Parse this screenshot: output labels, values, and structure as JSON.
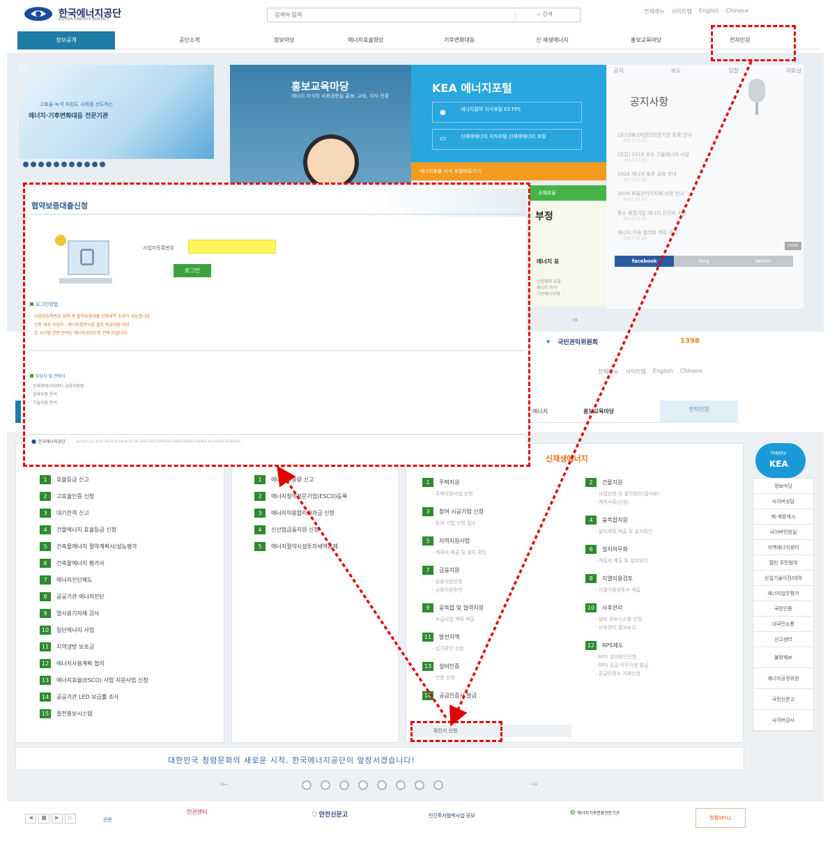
{
  "header": {
    "logo_text": "한국에너지공단",
    "logo_sub": "KOREA ENERGY AGENCY",
    "search_placeholder": "검색어 입력",
    "search_button": "검색",
    "top_links": [
      "전체메뉴",
      "사이트맵",
      "English",
      "Chinese"
    ]
  },
  "nav": {
    "items": [
      "정보공개",
      "공단소개",
      "정보마당",
      "에너지효율향상",
      "기후변화대응",
      "신·재생에너지",
      "홍보교육마당",
      "전자민원"
    ]
  },
  "banner": {
    "left_line1": "고효율·녹색 자원도 사회를 선도하는",
    "left_line2": "에너지·기후변화대응 전문기관",
    "promo_title": "홍보교육마당",
    "promo_desc": "에너지 지식의 사회공헌을 홍보, 교육, 지식 전환",
    "portal_title": "KEA 에너지포털",
    "portal_btn1": "에너지절약 지식포털 ES·FPS",
    "portal_btn2": "신재생에너지 지식포털 신재생에너지 포털",
    "strip_text": "에너지효율 지식 포털바로가기",
    "bottom_text": "소재효율",
    "bottom_frag": "부정",
    "bottom_frag2": "에너지 표",
    "energy_lines": [
      "산업체의 효율",
      "에너지 지식",
      "기존에너지에"
    ]
  },
  "notice": {
    "tabs": [
      "공지",
      "보도",
      "입찰",
      "자료실"
    ],
    "title": "공지사항",
    "items": [
      {
        "text": "[공고]에너지진단전문기관 등록 안내",
        "date": "2017.10.31"
      },
      {
        "text": "[모집] 2018 우수 건물에너지 사업",
        "date": "2017.10.31"
      },
      {
        "text": "2018 에너지 표준 교육 안내",
        "date": "2017.10.30"
      },
      {
        "text": "2018 효율관리기자재 신청 안내",
        "date": "2017.10.27"
      },
      {
        "text": "중소 중견기업 에너지 진단비 지원",
        "date": "2017.10.25"
      },
      {
        "text": "에너지 이용 합리화 계획 공고",
        "date": "2017.10.24"
      }
    ],
    "more_label": "more",
    "sns_tabs": [
      "facebook",
      "blog",
      "twitter"
    ]
  },
  "popup": {
    "title": "협약보증대출신청",
    "field_label": "사업자등록번호",
    "login_button": "로그인",
    "guide_title": "로그인방법",
    "guide_lines": [
      "사업자등록번호 입력 후 협약보증대출 신청내역 조회가 가능합니다.",
      "신청 대상 사업자 : 에너지절약시설 설치 자금지원 대상",
      "본 시스템 관련 문의는 에너지공단으로 연락 바랍니다."
    ],
    "contact_title": "담당자 및 연락처",
    "contact_lines": [
      "신재생에너지센터 금융지원팀",
      "협약보증 문의",
      "기술지원 문의"
    ],
    "footer_brand": "한국에너지공단",
    "footer_text": "울산광역시 중구 종가로 405-11 한국에너지공단 TEL 1855-3020 COPYRIGHT KOREA ENERGY AGENCY. ALL RIGHTS RESERVED."
  },
  "second_page": {
    "gov_logo": "국민권익위원회",
    "hotline": "1398",
    "top_links": [
      "전체메뉴",
      "사이트맵",
      "English",
      "Chinese"
    ],
    "nav_visible": [
      "에너지",
      "홍보교육마당",
      "전자민원"
    ]
  },
  "services": {
    "col1": [
      {
        "num": "1",
        "label": "효율등급 신고"
      },
      {
        "num": "2",
        "label": "고효율인증 신청"
      },
      {
        "num": "3",
        "label": "대기전력 신고"
      },
      {
        "num": "4",
        "label": "건물에너지 효율등급 신청"
      },
      {
        "num": "5",
        "label": "건축물에너지 절약계획서/성능평가"
      },
      {
        "num": "6",
        "label": "건축물에너지 평가사"
      },
      {
        "num": "7",
        "label": "에너지진단제도"
      },
      {
        "num": "8",
        "label": "공공기관 에너지진단"
      },
      {
        "num": "9",
        "label": "열사용기자재 검사"
      },
      {
        "num": "10",
        "label": "집단에너지 사업"
      },
      {
        "num": "11",
        "label": "지역냉방 보조금"
      },
      {
        "num": "12",
        "label": "에너지사용계획 협의"
      },
      {
        "num": "13",
        "label": "에너지효율(ESCO) 사업 지원사업 신청"
      },
      {
        "num": "14",
        "label": "공공기관 LED 보급률 조사"
      },
      {
        "num": "15",
        "label": "절전홍보시스템"
      }
    ],
    "col2": [
      {
        "num": "1",
        "label": "에너지사용량 신고"
      },
      {
        "num": "2",
        "label": "에너지절약전문기업(ESCO)등록"
      },
      {
        "num": "3",
        "label": "에너지이용합리화자금 신청"
      },
      {
        "num": "4",
        "label": "신산업금융지원 신청"
      },
      {
        "num": "5",
        "label": "에너지절약시설투자세액공제"
      }
    ],
    "col3_title": "신재생에너지",
    "col3a": [
      {
        "num": "1",
        "label": "주택지원",
        "sub": [
          "주택지원사업 신청"
        ]
      },
      {
        "num": "3",
        "label": "참여 시공기업 신청",
        "sub": [
          "참여 기업 신청 접수"
        ]
      },
      {
        "num": "5",
        "label": "지역지원사업",
        "sub": [
          "계획서 제출 및 설치 확인"
        ]
      },
      {
        "num": "7",
        "label": "금융지원",
        "sub": [
          "금융지원신청",
          "금융지원추천"
        ]
      },
      {
        "num": "9",
        "label": "융복합 및 협력지원",
        "sub": [
          "보급사업 계획 제출"
        ]
      },
      {
        "num": "11",
        "label": "발전차액",
        "sub": [
          "설치확인 신청"
        ]
      },
      {
        "num": "13",
        "label": "설비인증",
        "sub": [
          "인증 신청"
        ]
      },
      {
        "num": "14",
        "label": "공급인증서 발급",
        "sub": []
      }
    ],
    "col3b": [
      {
        "num": "2",
        "label": "건물지원",
        "sub": [
          "사업신청 및 설치확인(열사용)",
          "계약서류(신청)"
        ]
      },
      {
        "num": "4",
        "label": "융복합지원",
        "sub": [
          "설치계획 제출 및 설치확인"
        ]
      },
      {
        "num": "6",
        "label": "설치의무화",
        "sub": [
          "계획서 제출 및 설치확인"
        ]
      },
      {
        "num": "8",
        "label": "지열이용검토",
        "sub": [
          "지열이용검토서 제출"
        ]
      },
      {
        "num": "10",
        "label": "사후관리",
        "sub": [
          "설비 정보시스템 신청",
          "사후관리 결과보고"
        ]
      },
      {
        "num": "12",
        "label": "RPS제도",
        "sub": [
          "RPS 설비확인신청",
          "RPS 공급 의무이행 발급",
          "공급인증서 거래신청"
        ]
      }
    ],
    "cert_button": "확인서 신청"
  },
  "right_sidebar": {
    "badge": "KEA",
    "badge_top": "Happy",
    "items": [
      "정보마당",
      "사이버상담",
      "해·계량게시",
      "사이버민원실",
      "지역에너지센터",
      "열린 주민참여",
      "산업기술이전/대여",
      "에너지업무평가",
      "국민인증",
      "대국민소통",
      "신고센터"
    ],
    "links": [
      "불량제보",
      "에너지공정위원",
      "국민신문고",
      "사이버감사"
    ]
  },
  "marquee": {
    "text": "대한민국 청렴문화의 새로운 시작, 한국에너지공단이 앞장서겠습니다!"
  },
  "footer": {
    "related": "관련",
    "banners": [
      "인권센터",
      "안전신문고",
      "민간투자협력사업 공모",
      "에너지기후변화전문기관",
      "청렴SKILL"
    ]
  },
  "colors": {
    "nav_active": "#1e7da7",
    "gnum": "#2f8a2f",
    "redbox": "#e00000",
    "kea_blue": "#1a9ad6",
    "dark_blue": "#2d7bc0",
    "popup_btn": "#3ca23c"
  }
}
